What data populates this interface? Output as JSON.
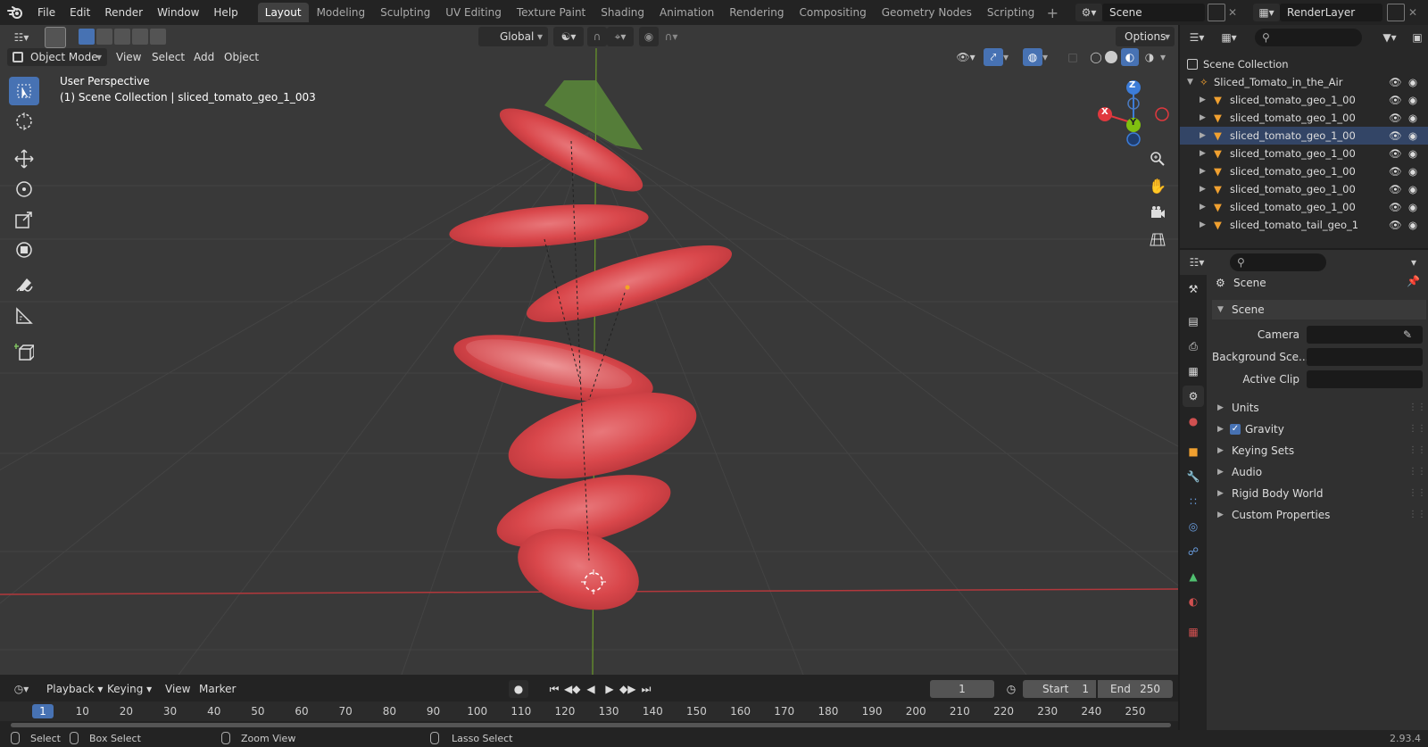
{
  "menubar": {
    "items": [
      "File",
      "Edit",
      "Render",
      "Window",
      "Help"
    ],
    "workspaces": [
      "Layout",
      "Modeling",
      "Sculpting",
      "UV Editing",
      "Texture Paint",
      "Shading",
      "Animation",
      "Rendering",
      "Compositing",
      "Geometry Nodes",
      "Scripting"
    ],
    "active_workspace": "Layout",
    "scene_name": "Scene",
    "view_layer": "RenderLayer"
  },
  "viewport": {
    "mode": "Object Mode",
    "menus": [
      "View",
      "Select",
      "Add",
      "Object"
    ],
    "orientation": "Global",
    "options_label": "Options",
    "info_line1": "User Perspective",
    "info_line2": "(1) Scene Collection | sliced_tomato_geo_1_003",
    "gizmo_labels": {
      "x": "X",
      "y": "Y",
      "z": "Z"
    }
  },
  "outliner": {
    "root": "Scene Collection",
    "collection": "Sliced_Tomato_in_the_Air",
    "items": [
      "sliced_tomato_geo_1_00",
      "sliced_tomato_geo_1_00",
      "sliced_tomato_geo_1_00",
      "sliced_tomato_geo_1_00",
      "sliced_tomato_geo_1_00",
      "sliced_tomato_geo_1_00",
      "sliced_tomato_geo_1_00",
      "sliced_tomato_tail_geo_1"
    ]
  },
  "properties": {
    "context_title": "Scene",
    "panel_title": "Scene",
    "camera_label": "Camera",
    "background_label": "Background Sce...",
    "active_clip_label": "Active Clip",
    "subpanels": [
      "Units",
      "Gravity",
      "Keying Sets",
      "Audio",
      "Rigid Body World",
      "Custom Properties"
    ],
    "gravity_checked": true
  },
  "timeline": {
    "menus": [
      "Playback",
      "Keying",
      "View",
      "Marker"
    ],
    "current_frame": "1",
    "start_label": "Start",
    "start_value": "1",
    "end_label": "End",
    "end_value": "250",
    "ruler": [
      "1",
      "10",
      "20",
      "30",
      "40",
      "50",
      "60",
      "70",
      "80",
      "90",
      "100",
      "110",
      "120",
      "130",
      "140",
      "150",
      "160",
      "170",
      "180",
      "190",
      "200",
      "210",
      "220",
      "230",
      "240",
      "250"
    ]
  },
  "statusbar": {
    "select": "Select",
    "box_select": "Box Select",
    "zoom_view": "Zoom View",
    "lasso_select": "Lasso Select",
    "version": "2.93.4"
  },
  "colors": {
    "accent": "#4772b3",
    "x_axis": "#e0383e",
    "y_axis": "#80c010",
    "z_axis": "#3c7cd8",
    "tomato": "#d9474b"
  }
}
